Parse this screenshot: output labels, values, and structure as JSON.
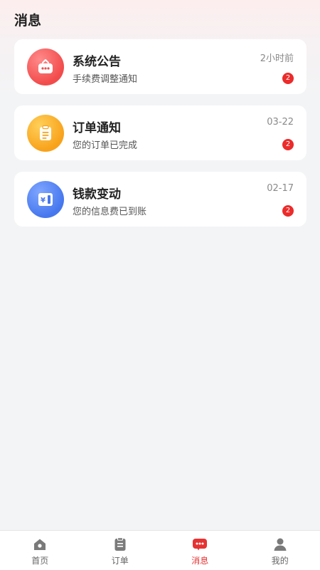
{
  "header": {
    "title": "消息"
  },
  "messages": [
    {
      "title": "系统公告",
      "subtitle": "手续费调整通知",
      "time": "2小时前",
      "badge": "2",
      "icon": "store-icon"
    },
    {
      "title": "订单通知",
      "subtitle": "您的订单已完成",
      "time": "03-22",
      "badge": "2",
      "icon": "clipboard-icon"
    },
    {
      "title": "钱款变动",
      "subtitle": "您的信息费已到账",
      "time": "02-17",
      "badge": "2",
      "icon": "wallet-icon"
    }
  ],
  "tabbar": {
    "items": [
      {
        "label": "首页",
        "icon": "home-icon"
      },
      {
        "label": "订单",
        "icon": "order-icon"
      },
      {
        "label": "消息",
        "icon": "message-icon",
        "active": true
      },
      {
        "label": "我的",
        "icon": "user-icon"
      }
    ]
  },
  "colors": {
    "accent": "#e63232",
    "badge": "#ec2b2b",
    "icon_red": "#f24b4b",
    "icon_orange": "#f8a21b",
    "icon_blue": "#4677ee"
  }
}
